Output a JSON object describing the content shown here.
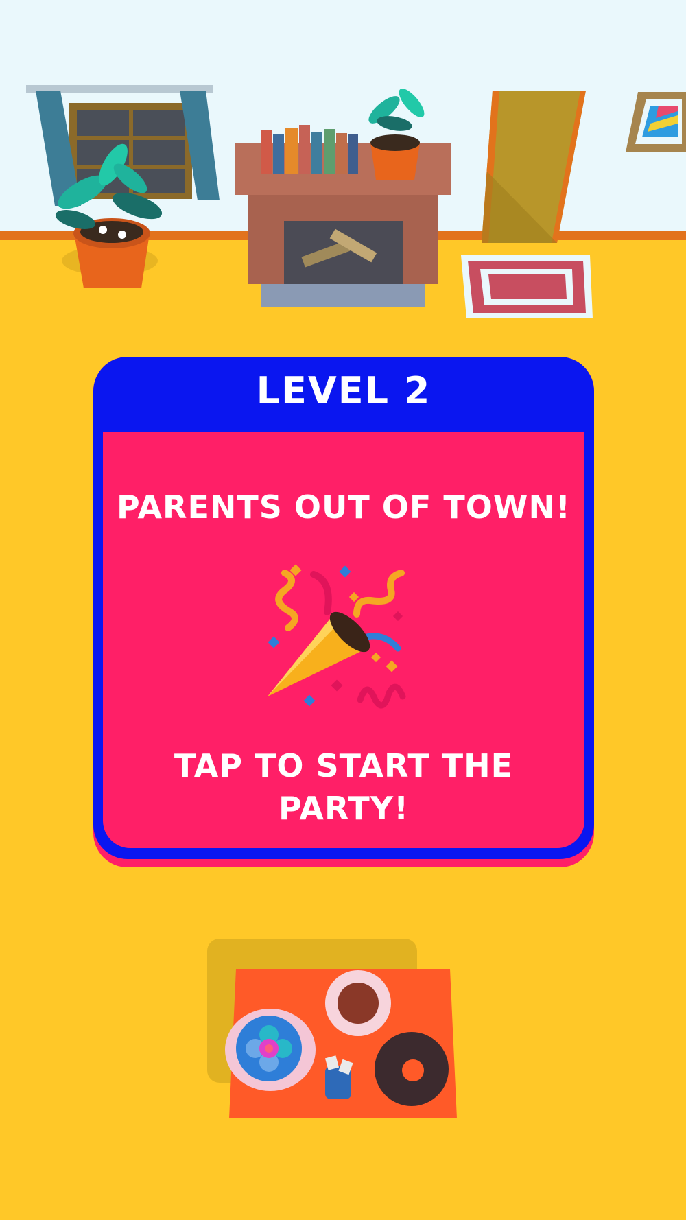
{
  "level": {
    "title": "LEVEL 2",
    "headline": "PARENTS OUT OF TOWN!",
    "call_to_action": "TAP TO START THE PARTY!",
    "emoji_icon": "party-popper-icon"
  },
  "colors": {
    "floor": "#FFC828",
    "wall": "#EAF8FC",
    "card_blue": "#0A16F0",
    "card_pink": "#FF1F67",
    "text": "#FFFFFF"
  }
}
